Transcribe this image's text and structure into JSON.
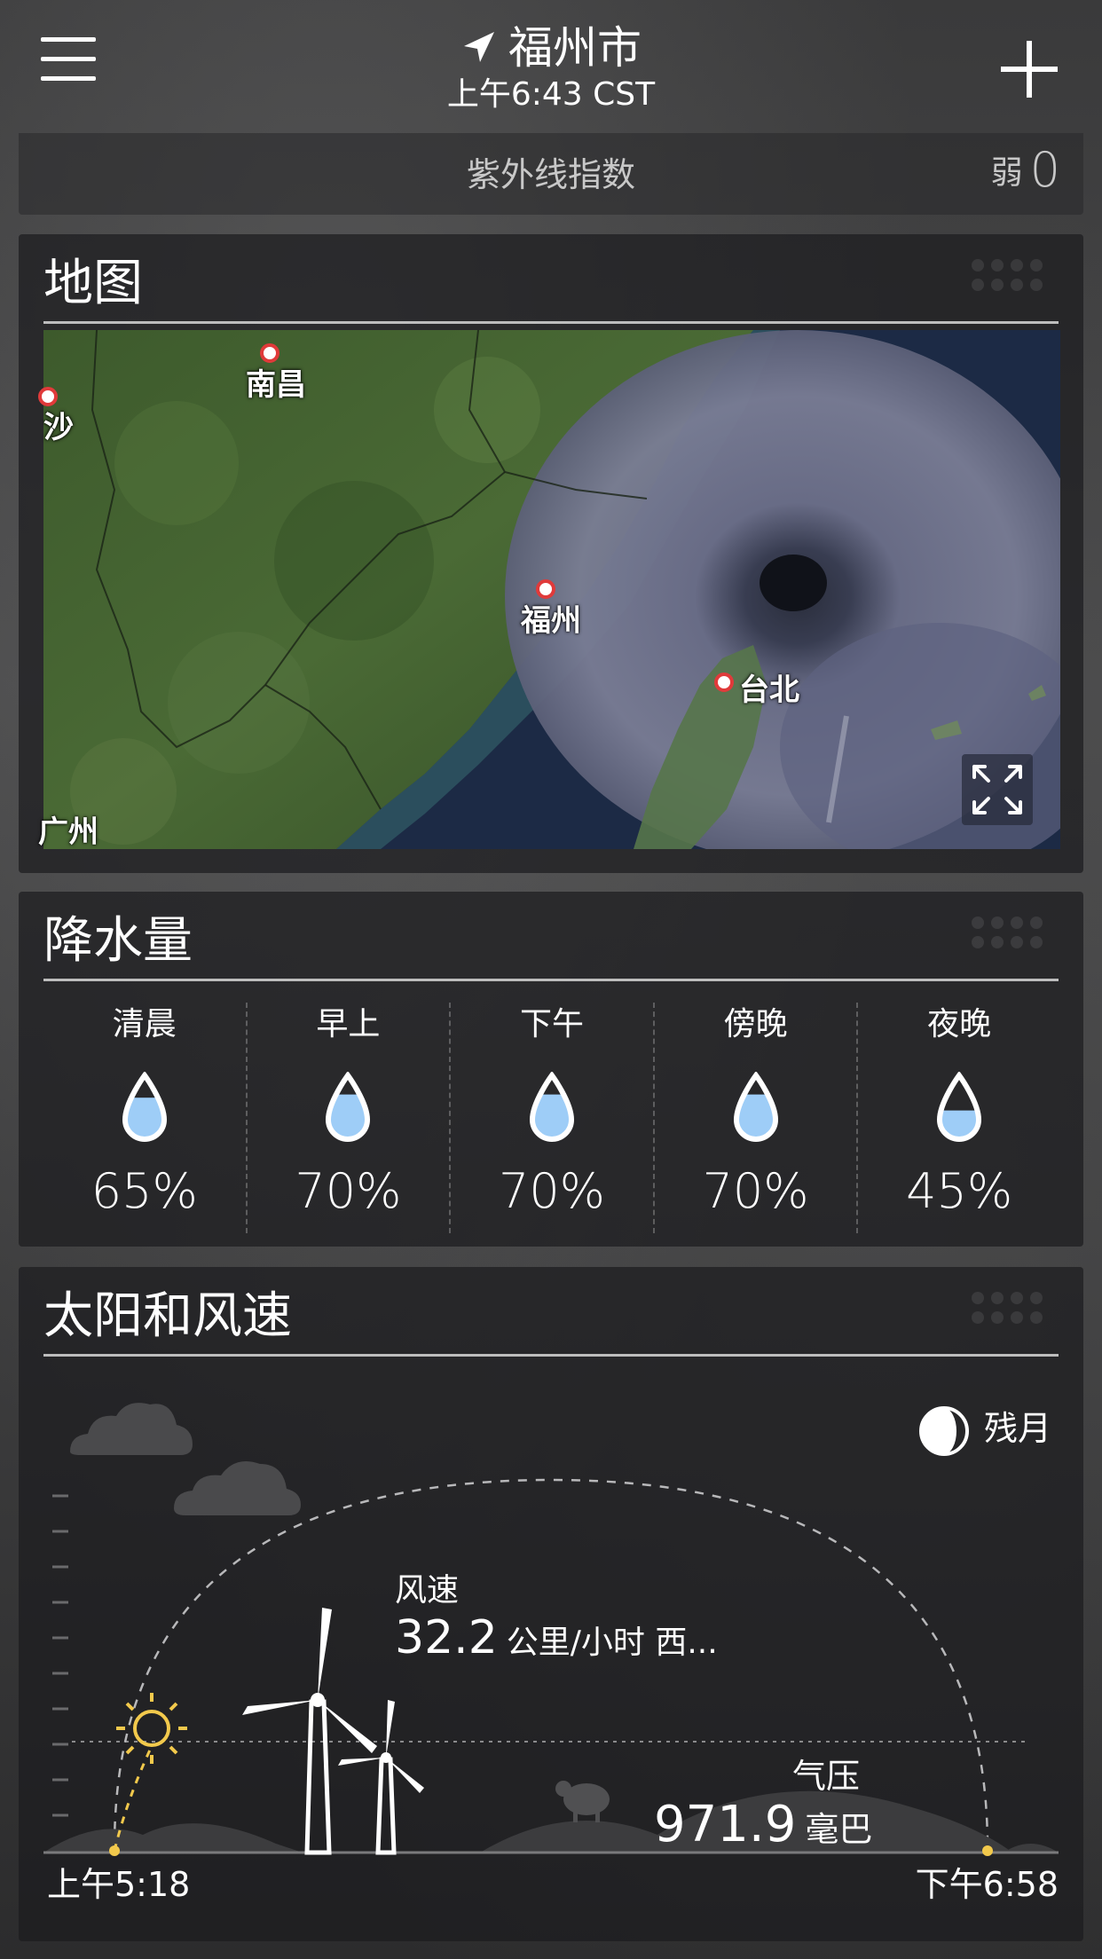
{
  "header": {
    "location": "福州市",
    "time": "上午6:43 CST",
    "menu_icon": "hamburger-menu-icon",
    "add_icon": "plus-icon",
    "location_icon": "location-arrow-icon"
  },
  "uv": {
    "label": "紫外线指数",
    "level": "弱",
    "value": "0"
  },
  "map": {
    "title": "地图",
    "places": [
      {
        "name": "南昌"
      },
      {
        "name": "沙"
      },
      {
        "name": "福州"
      },
      {
        "name": "台北"
      },
      {
        "name": "广州"
      }
    ],
    "expand_icon": "expand-arrows-icon"
  },
  "precipitation": {
    "title": "降水量",
    "periods": [
      {
        "label": "清晨",
        "value": "65%",
        "fill": 0.65
      },
      {
        "label": "早上",
        "value": "70%",
        "fill": 0.7
      },
      {
        "label": "下午",
        "value": "70%",
        "fill": 0.7
      },
      {
        "label": "傍晚",
        "value": "70%",
        "fill": 0.7
      },
      {
        "label": "夜晚",
        "value": "45%",
        "fill": 0.45
      }
    ],
    "drop_icon": "water-drop-icon"
  },
  "sun_wind": {
    "title": "太阳和风速",
    "moon_phase": "残月",
    "moon_icon": "waning-moon-icon",
    "wind_label": "风速",
    "wind_value": "32.2",
    "wind_unit": "公里/小时 西...",
    "pressure_label": "气压",
    "pressure_value": "971.9",
    "pressure_unit": "毫巴",
    "sunrise": "上午5:18",
    "sunset": "下午6:58",
    "sun_progress": 0.08
  },
  "colors": {
    "accent_sun": "#f2c94c",
    "drop_fill": "#9ecdf7",
    "pin": "#e03a3a"
  }
}
